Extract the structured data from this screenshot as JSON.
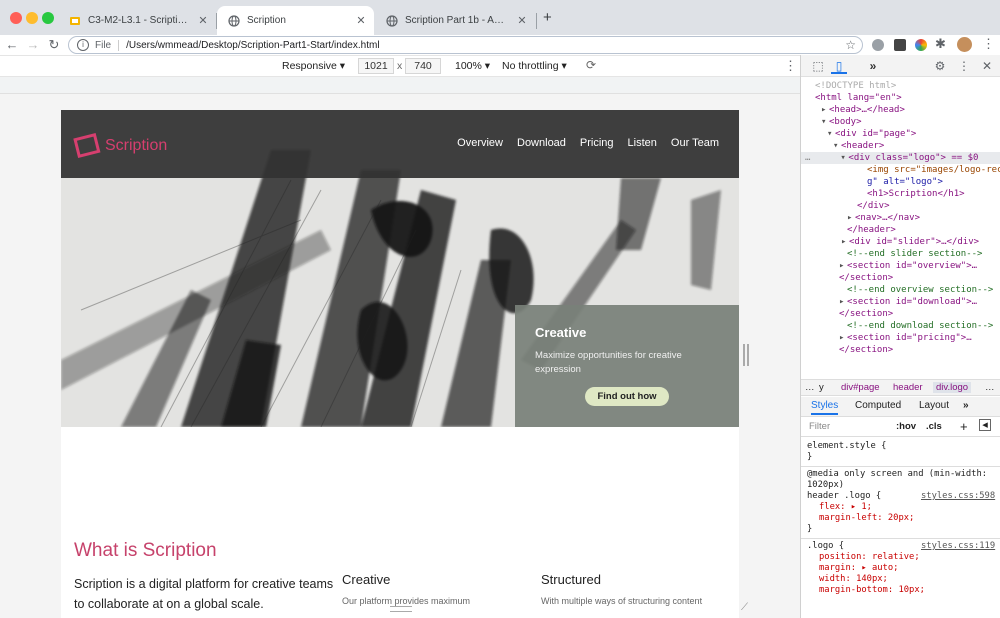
{
  "browser": {
    "tabs": [
      {
        "title": "C3-M2-L3.1 - Scription Site - "
      },
      {
        "title": "Scription"
      },
      {
        "title": "Scription Part 1b - Adding CSS"
      }
    ],
    "new_tab": "+",
    "url_scheme": "File",
    "url": "/Users/wmmead/Desktop/Scription-Part1-Start/index.html"
  },
  "device_toolbar": {
    "mode": "Responsive",
    "width": "1021",
    "times": "x",
    "height": "740",
    "zoom": "100%",
    "throttling": "No throttling"
  },
  "site": {
    "logo_text": "Scription",
    "nav": [
      "Overview",
      "Download",
      "Pricing",
      "Listen",
      "Our Team"
    ],
    "slide": {
      "heading": "Creative",
      "text": "Maximize opportunities for creative expression",
      "button": "Find out how"
    },
    "section_title": "What is Scription",
    "lede": "Scription is a digital platform for creative teams to collaborate at on a global scale.",
    "columns": [
      {
        "heading": "Creative",
        "text": "Our platform provides maximum"
      },
      {
        "heading": "Structured",
        "text": "With multiple ways of structuring content"
      }
    ]
  },
  "devtools": {
    "panel_tab": "»",
    "dom": [
      "<!DOCTYPE html>",
      "<html lang=\"en\">",
      "<head>…</head>",
      "<body>",
      "<div id=\"page\">",
      "<header>",
      "<div class=\"logo\"> == $0",
      "<img src=\"images/logo-rec",
      "g\" alt=\"logo\">",
      "<h1>Scription</h1>",
      "</div>",
      "<nav>…</nav>",
      "</header>",
      "<div id=\"slider\">…</div>",
      "<!--end slider section-->",
      "<section id=\"overview\">…",
      "</section>",
      "<!--end overview section-->",
      "<section id=\"download\">…",
      "</section>",
      "<!--end download section-->",
      "<section id=\"pricing\">…",
      "</section>"
    ],
    "breadcrumbs": [
      "…",
      "y",
      "div#page",
      "header",
      "div.logo",
      "…"
    ],
    "style_tabs": [
      "Styles",
      "Computed",
      "Layout",
      "»"
    ],
    "filter_placeholder": "Filter",
    "hov": ":hov",
    "cls": ".cls",
    "rules": [
      "element.style {",
      "}",
      "@media only screen and (min-width:",
      "1020px)",
      "header .logo {",
      "flex: ▸ 1;",
      "margin-left: 20px;",
      "}",
      ".logo {",
      "position: relative;",
      "margin: ▸ auto;",
      "width: 140px;",
      "margin-bottom: 10px;"
    ],
    "sources": [
      "styles.css:598",
      "styles.css:119"
    ]
  },
  "colors": {
    "brand": "#d63f6f",
    "header_bg": "#333333",
    "button_bg": "#dfe8c4"
  }
}
